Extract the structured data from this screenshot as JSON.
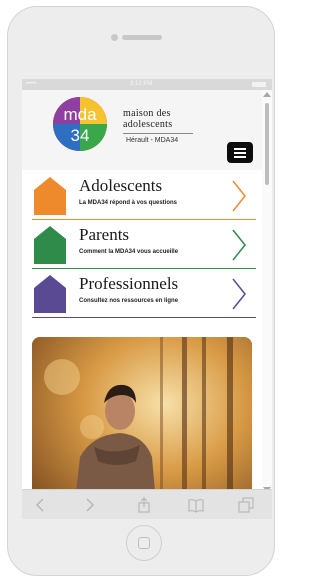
{
  "statusbar": {
    "carrier": "•••••",
    "time": "3:12 PM"
  },
  "header": {
    "logo_text_top": "mda",
    "logo_text_bottom": "34",
    "org_name": "maison des adolescents",
    "org_sub": "Hérault - MDA34"
  },
  "nav": [
    {
      "title": "Adolescents",
      "subtitle": "La MDA34 répond à vos questions",
      "color": "#ef8a2c"
    },
    {
      "title": "Parents",
      "subtitle": "Comment la MDA34 vous accueille",
      "color": "#2f8b4a"
    },
    {
      "title": "Professionnels",
      "subtitle": "Consultez nos ressources en ligne",
      "color": "#5a4a94"
    }
  ],
  "colors": {
    "toolbar": "#e3e3e3",
    "menu_button": "#0c0c0c"
  },
  "icons": [
    "menu-icon",
    "back-icon",
    "forward-icon",
    "share-icon",
    "bookmarks-icon",
    "tabs-icon",
    "home-button"
  ]
}
